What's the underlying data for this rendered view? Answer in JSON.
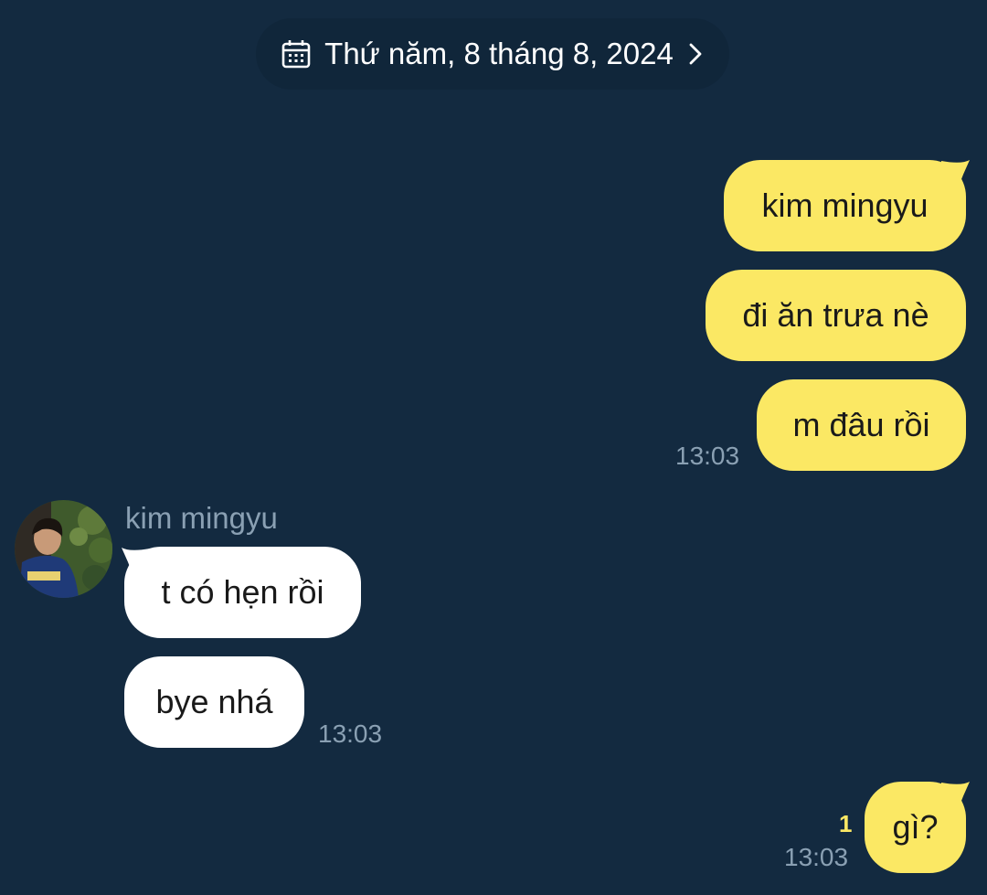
{
  "date_divider": {
    "label": "Thứ năm, 8 tháng 8, 2024",
    "icon": "calendar-icon",
    "chevron": "chevron-right-icon"
  },
  "outgoing_group_1": {
    "messages": [
      "kim mingyu",
      "đi ăn trưa nè",
      "m đâu rồi"
    ],
    "time": "13:03"
  },
  "incoming_group": {
    "sender": "kim mingyu",
    "messages": [
      "t có hẹn rồi",
      "bye nhá"
    ],
    "time": "13:03"
  },
  "outgoing_group_2": {
    "messages": [
      "gì?"
    ],
    "time": "13:03",
    "unread_count": "1"
  },
  "colors": {
    "background": "#132a40",
    "outgoing_bubble": "#fbe864",
    "incoming_bubble": "#ffffff",
    "timestamp": "#8aa0b3",
    "unread": "#fbe864"
  }
}
